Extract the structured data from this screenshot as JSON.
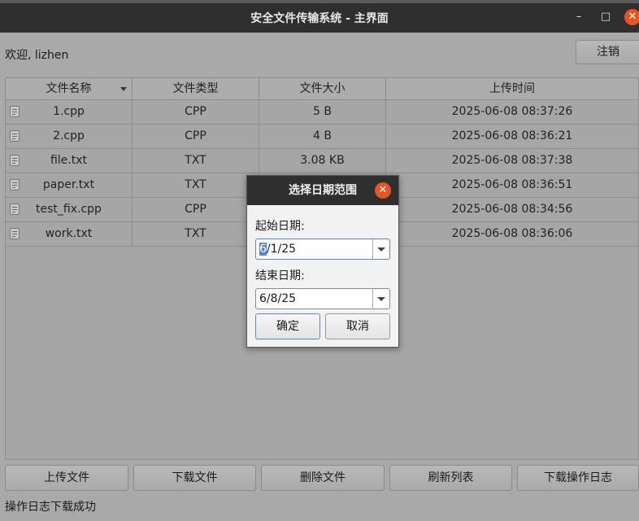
{
  "window": {
    "title": "安全文件传输系统 - 主界面",
    "minimize_glyph": "–",
    "maximize_glyph": "□",
    "close_glyph": "✕"
  },
  "header": {
    "welcome": "欢迎, lizhen",
    "logout_label": "注销"
  },
  "table": {
    "columns": [
      "文件名称",
      "文件类型",
      "文件大小",
      "上传时间"
    ],
    "rows": [
      {
        "name": "1.cpp",
        "type": "CPP",
        "size": "5 B",
        "time": "2025-06-08 08:37:26"
      },
      {
        "name": "2.cpp",
        "type": "CPP",
        "size": "4 B",
        "time": "2025-06-08 08:36:21"
      },
      {
        "name": "file.txt",
        "type": "TXT",
        "size": "3.08 KB",
        "time": "2025-06-08 08:37:38"
      },
      {
        "name": "paper.txt",
        "type": "TXT",
        "size": "",
        "time": "2025-06-08 08:36:51"
      },
      {
        "name": "test_fix.cpp",
        "type": "CPP",
        "size": "",
        "time": "2025-06-08 08:34:56"
      },
      {
        "name": "work.txt",
        "type": "TXT",
        "size": "",
        "time": "2025-06-08 08:36:06"
      }
    ]
  },
  "actions": {
    "upload": "上传文件",
    "download": "下载文件",
    "delete": "删除文件",
    "refresh": "刷新列表",
    "download_log": "下载操作日志"
  },
  "status": "操作日志下载成功",
  "dialog": {
    "title": "选择日期范围",
    "close_glyph": "✕",
    "start_label": "起始日期:",
    "start_value_selected": "6",
    "start_value_rest": "/1/25",
    "end_label": "结束日期:",
    "end_value": "6/8/25",
    "ok_label": "确定",
    "cancel_label": "取消"
  }
}
